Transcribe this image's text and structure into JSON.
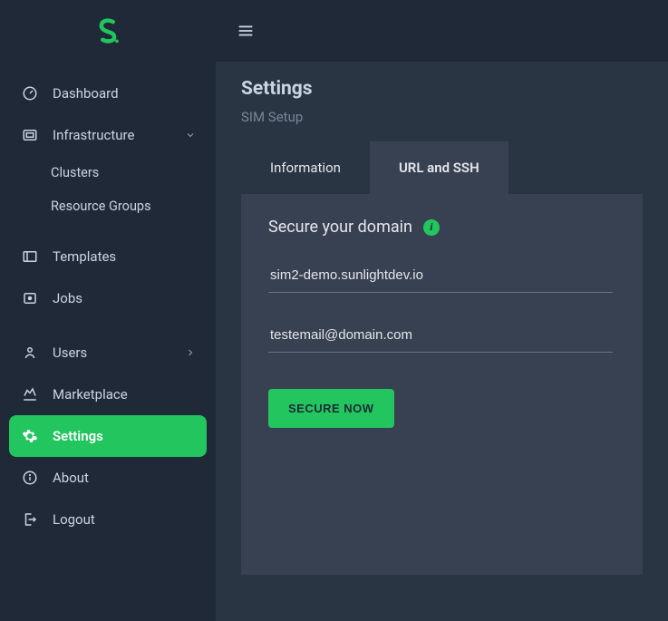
{
  "brand": {
    "logo_letter": "S"
  },
  "sidebar": {
    "items": [
      {
        "label": "Dashboard"
      },
      {
        "label": "Infrastructure"
      },
      {
        "label": "Templates"
      },
      {
        "label": "Jobs"
      },
      {
        "label": "Users"
      },
      {
        "label": "Marketplace"
      },
      {
        "label": "Settings"
      },
      {
        "label": "About"
      },
      {
        "label": "Logout"
      }
    ],
    "infra_sub": [
      {
        "label": "Clusters"
      },
      {
        "label": "Resource Groups"
      }
    ]
  },
  "page": {
    "title": "Settings",
    "subtitle": "SIM Setup"
  },
  "tabs": [
    {
      "label": "Information"
    },
    {
      "label": "URL and SSH"
    }
  ],
  "secure_section": {
    "heading": "Secure your domain",
    "info_glyph": "i",
    "domain_value": "sim2-demo.sunlightdev.io",
    "email_value": "testemail@domain.com",
    "button_label": "SECURE NOW"
  },
  "colors": {
    "accent": "#22c55e",
    "sidebar_bg": "#1f2937",
    "main_bg": "#2a3544",
    "panel_bg": "#374151"
  }
}
